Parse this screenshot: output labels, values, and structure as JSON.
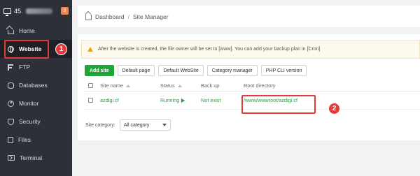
{
  "app": {
    "server_label": "45.",
    "notification_count": "0"
  },
  "sidebar": {
    "items": [
      {
        "label": "Home",
        "icon": "home-icon"
      },
      {
        "label": "Website",
        "icon": "globe-icon",
        "active": true
      },
      {
        "label": "FTP",
        "icon": "ftp-icon"
      },
      {
        "label": "Databases",
        "icon": "database-icon"
      },
      {
        "label": "Monitor",
        "icon": "monitor-icon"
      },
      {
        "label": "Security",
        "icon": "shield-icon"
      },
      {
        "label": "Files",
        "icon": "file-icon"
      },
      {
        "label": "Terminal",
        "icon": "terminal-icon"
      }
    ]
  },
  "breadcrumb": {
    "home": "Dashboard",
    "separator": "/",
    "current": "Site Manager"
  },
  "notice": {
    "text": "After the website is created, the file owner will be set to [www]. You can add your backup plan in [Cron]"
  },
  "toolbar": {
    "add_site": "Add site",
    "default_page": "Default page",
    "default_website": "Default WebSite",
    "category_manager": "Category manager",
    "php_cli": "PHP CLI version"
  },
  "table": {
    "headers": {
      "site_name": "Site name",
      "status": "Status",
      "backup": "Back up",
      "root": "Root directory"
    },
    "rows": [
      {
        "site_name": "azdigi.cf",
        "status": "Running",
        "backup": "Not exist",
        "root": "/www/wwwroot/azdigi.cf"
      }
    ]
  },
  "filter": {
    "label": "Site category:",
    "selected": "All category"
  },
  "annotations": {
    "marker_1": "1",
    "marker_2": "2",
    "highlight_color": "#e23b3b"
  },
  "colors": {
    "sidebar_bg": "#2d3038",
    "accent_green": "#20a53a",
    "badge_orange": "#f0874a"
  }
}
